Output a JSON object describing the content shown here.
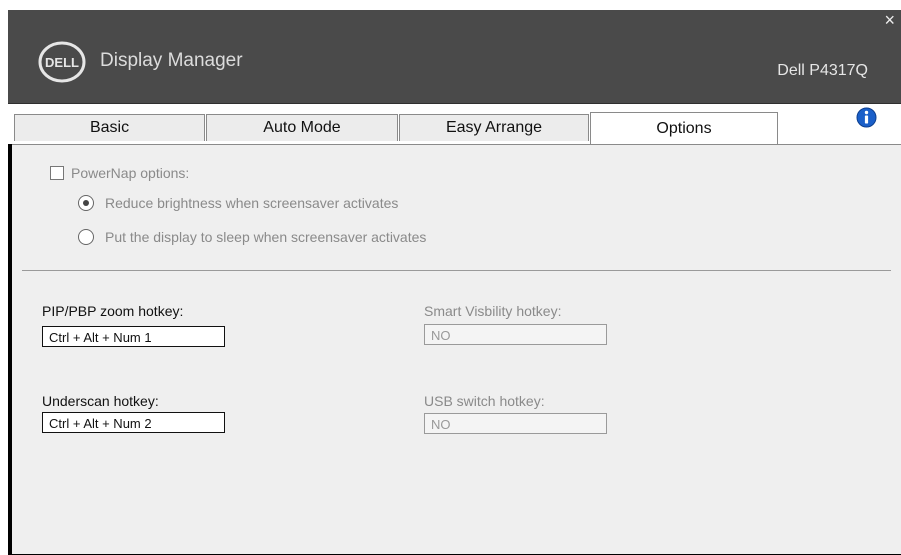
{
  "window": {
    "app_title": "Display Manager",
    "monitor_name": "Dell P4317Q",
    "close_symbol": "×",
    "logo_text": "DELL"
  },
  "tabs": [
    {
      "label": "Basic"
    },
    {
      "label": "Auto Mode"
    },
    {
      "label": "Easy Arrange"
    },
    {
      "label": "Options",
      "active": true
    }
  ],
  "icons": {
    "info": "info-icon"
  },
  "options": {
    "powernap_label": "PowerNap options:",
    "powernap_checked": false,
    "radio_reduce_label": "Reduce brightness when screensaver activates",
    "radio_sleep_label": "Put the display to sleep when screensaver activates",
    "selected_radio": "reduce"
  },
  "hotkeys": {
    "pip_label": "PIP/PBP zoom hotkey:",
    "pip_value": "Ctrl + Alt + Num 1",
    "underscan_label": "Underscan hotkey:",
    "underscan_value": "Ctrl + Alt + Num 2",
    "smart_label": "Smart Visbility hotkey:",
    "smart_value": "NO",
    "usb_label": "USB switch hotkey:",
    "usb_value": "NO"
  },
  "colors": {
    "titlebar": "#4a4a4a",
    "content_bg": "#efefef",
    "info_blue": "#1a5fc9"
  }
}
